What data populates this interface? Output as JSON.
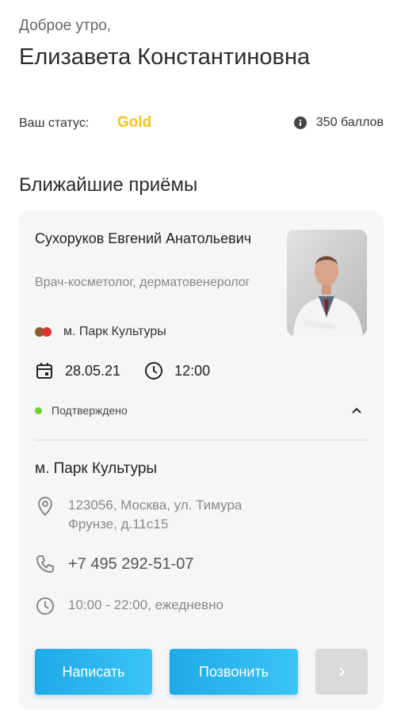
{
  "header": {
    "greeting": "Доброе утро,",
    "username": "Елизавета Константиновна",
    "status_label": "Ваш статус:",
    "status_value": "Gold",
    "points": "350 баллов"
  },
  "appointments": {
    "section_title": "Ближайшие приёмы",
    "items": [
      {
        "doctor_name": "Сухоруков Евгений Анатольевич",
        "doctor_role": "Врач-косметолог, дерматовенеролог",
        "metro": "м. Парк Культуры",
        "date": "28.05.21",
        "time": "12:00",
        "status": "Подтверждено",
        "clinic": {
          "name": "м. Парк Культуры",
          "address": "123056, Москва, ул. Тимура Фрунзе, д.11с15",
          "phone": "+7 495 292-51-07",
          "hours": "10:00 - 22:00, ежедневно"
        },
        "buttons": {
          "write": "Написать",
          "call": "Позвонить",
          "next": "›"
        }
      }
    ]
  },
  "colors": {
    "gold": "#f0c419",
    "accent": "#1fa9e8",
    "confirmed": "#6fd233",
    "metro_line_1": "#8b5a2b",
    "metro_line_2": "#e03030"
  }
}
